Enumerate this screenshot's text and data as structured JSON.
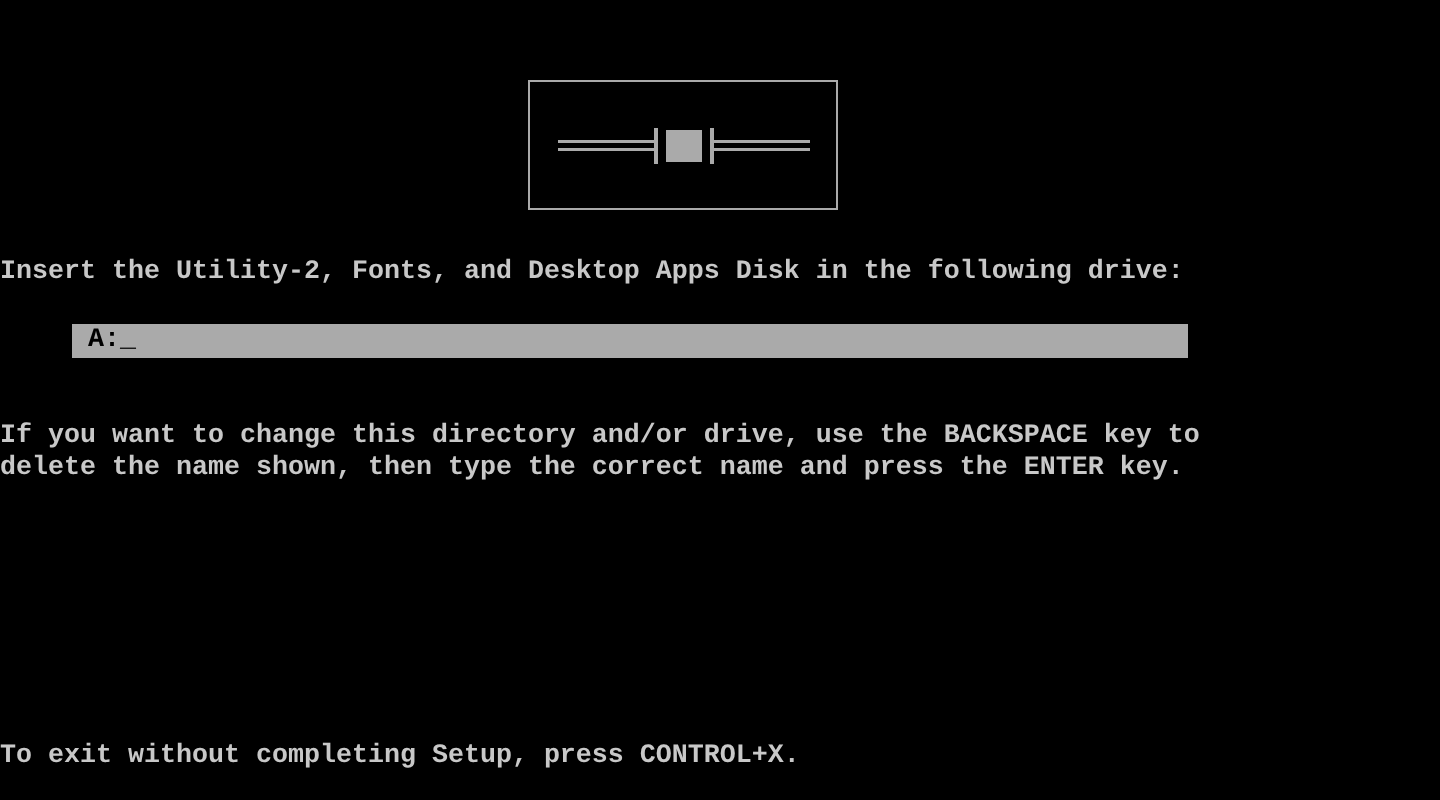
{
  "prompt": "Insert the Utility-2, Fonts, and Desktop Apps Disk in the following drive:",
  "drive_field": {
    "value": "A:_"
  },
  "instructions": [
    "If you want to change this directory and/or drive, use the BACKSPACE key to",
    "delete the name shown, then type the correct name and press the ENTER key."
  ],
  "exit_hint": "To exit without completing Setup, press CONTROL+X."
}
